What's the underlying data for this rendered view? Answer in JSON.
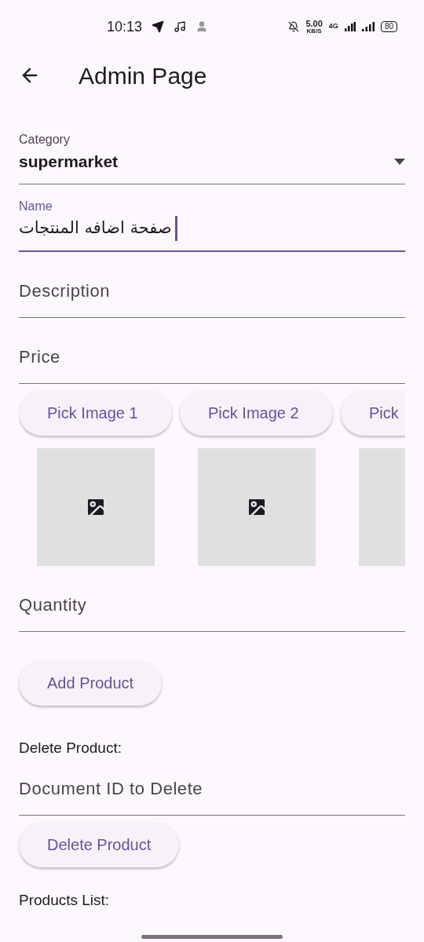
{
  "status_bar": {
    "time": "10:13",
    "speed_value": "5.00",
    "speed_unit": "KB/S",
    "network": "4G",
    "battery": "80"
  },
  "app_bar": {
    "title": "Admin Page"
  },
  "fields": [
    {
      "kind": "dropdown",
      "label": "Category",
      "value": "supermarket",
      "focused": false
    },
    {
      "kind": "text",
      "label": "Name",
      "value": "صفحة اضافه المنتجات",
      "focused": true
    },
    {
      "kind": "text",
      "placeholder": "Description",
      "focused": false
    },
    {
      "kind": "text",
      "placeholder": "Price",
      "focused": false
    }
  ],
  "image_pickers": [
    {
      "button": "Pick Image 1"
    },
    {
      "button": "Pick Image 2"
    },
    {
      "button": "Pick"
    }
  ],
  "quantity_field": {
    "placeholder": "Quantity",
    "focused": false
  },
  "add_button": "Add Product",
  "delete_section": {
    "heading": "Delete Product:",
    "field": {
      "placeholder": "Document ID to Delete",
      "focused": false
    },
    "button": "Delete Product"
  },
  "products_heading": "Products List:"
}
